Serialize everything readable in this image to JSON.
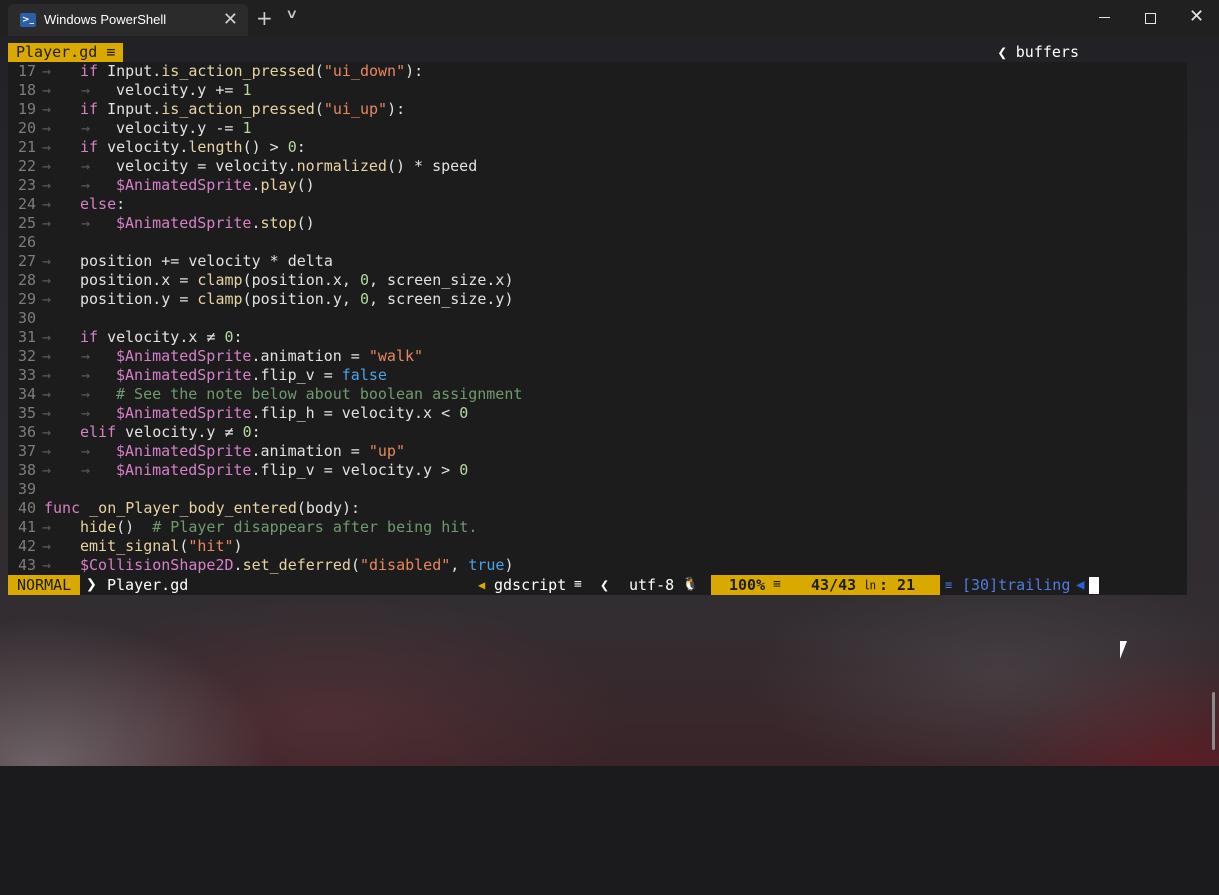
{
  "window": {
    "tab_title": "Windows PowerShell",
    "tab_close": "✕",
    "new_tab": "+",
    "tab_dropdown": "∨",
    "close_glyph": "✕"
  },
  "vim": {
    "buffer_tab": "Player.gd ≡",
    "buffers_label": "buffers",
    "buffers_chevron": "❮"
  },
  "editor": {
    "lines": [
      {
        "n": "17",
        "indent": 1,
        "tokens": [
          [
            "kw",
            "if "
          ],
          [
            "plain",
            "Input"
          ],
          [
            "plain",
            "."
          ],
          [
            "fn",
            "is_action_pressed"
          ],
          [
            "plain",
            "("
          ],
          [
            "str",
            "\"ui_down\""
          ],
          [
            "plain",
            "):"
          ]
        ]
      },
      {
        "n": "18",
        "indent": 2,
        "tokens": [
          [
            "plain",
            "velocity.y += "
          ],
          [
            "num",
            "1"
          ]
        ]
      },
      {
        "n": "19",
        "indent": 1,
        "tokens": [
          [
            "kw",
            "if "
          ],
          [
            "plain",
            "Input"
          ],
          [
            "plain",
            "."
          ],
          [
            "fn",
            "is_action_pressed"
          ],
          [
            "plain",
            "("
          ],
          [
            "str",
            "\"ui_up\""
          ],
          [
            "plain",
            "):"
          ]
        ]
      },
      {
        "n": "20",
        "indent": 2,
        "tokens": [
          [
            "plain",
            "velocity.y -= "
          ],
          [
            "num",
            "1"
          ]
        ]
      },
      {
        "n": "21",
        "indent": 1,
        "tokens": [
          [
            "kw",
            "if "
          ],
          [
            "plain",
            "velocity."
          ],
          [
            "fn",
            "length"
          ],
          [
            "plain",
            "() > "
          ],
          [
            "num",
            "0"
          ],
          [
            "plain",
            ":"
          ]
        ]
      },
      {
        "n": "22",
        "indent": 2,
        "tokens": [
          [
            "plain",
            "velocity = velocity."
          ],
          [
            "fn",
            "normalized"
          ],
          [
            "plain",
            "() * speed"
          ]
        ]
      },
      {
        "n": "23",
        "indent": 2,
        "tokens": [
          [
            "node",
            "$AnimatedSprite"
          ],
          [
            "plain",
            "."
          ],
          [
            "fn",
            "play"
          ],
          [
            "plain",
            "()"
          ]
        ]
      },
      {
        "n": "24",
        "indent": 1,
        "tokens": [
          [
            "kw",
            "else"
          ],
          [
            "plain",
            ":"
          ]
        ]
      },
      {
        "n": "25",
        "indent": 2,
        "tokens": [
          [
            "node",
            "$AnimatedSprite"
          ],
          [
            "plain",
            "."
          ],
          [
            "fn",
            "stop"
          ],
          [
            "plain",
            "()"
          ]
        ]
      },
      {
        "n": "26",
        "indent": 0,
        "tokens": []
      },
      {
        "n": "27",
        "indent": 1,
        "tokens": [
          [
            "plain",
            "position += velocity * delta"
          ]
        ]
      },
      {
        "n": "28",
        "indent": 1,
        "tokens": [
          [
            "plain",
            "position.x = "
          ],
          [
            "fn",
            "clamp"
          ],
          [
            "plain",
            "(position.x, "
          ],
          [
            "num",
            "0"
          ],
          [
            "plain",
            ", screen_size.x)"
          ]
        ]
      },
      {
        "n": "29",
        "indent": 1,
        "tokens": [
          [
            "plain",
            "position.y = "
          ],
          [
            "fn",
            "clamp"
          ],
          [
            "plain",
            "(position.y, "
          ],
          [
            "num",
            "0"
          ],
          [
            "plain",
            ", screen_size.y)"
          ]
        ]
      },
      {
        "n": "30",
        "indent": 0,
        "tokens": []
      },
      {
        "n": "31",
        "indent": 1,
        "tokens": [
          [
            "kw",
            "if "
          ],
          [
            "plain",
            "velocity.x ≠ "
          ],
          [
            "num",
            "0"
          ],
          [
            "plain",
            ":"
          ]
        ]
      },
      {
        "n": "32",
        "indent": 2,
        "tokens": [
          [
            "node",
            "$AnimatedSprite"
          ],
          [
            "plain",
            ".animation = "
          ],
          [
            "str",
            "\"walk\""
          ]
        ]
      },
      {
        "n": "33",
        "indent": 2,
        "tokens": [
          [
            "node",
            "$AnimatedSprite"
          ],
          [
            "plain",
            ".flip_v = "
          ],
          [
            "bool",
            "false"
          ]
        ]
      },
      {
        "n": "34",
        "indent": 2,
        "tokens": [
          [
            "cm",
            "# See the note below about boolean assignment"
          ]
        ]
      },
      {
        "n": "35",
        "indent": 2,
        "tokens": [
          [
            "node",
            "$AnimatedSprite"
          ],
          [
            "plain",
            ".flip_h = velocity.x < "
          ],
          [
            "num",
            "0"
          ]
        ]
      },
      {
        "n": "36",
        "indent": 1,
        "tokens": [
          [
            "kw",
            "elif "
          ],
          [
            "plain",
            "velocity.y ≠ "
          ],
          [
            "num",
            "0"
          ],
          [
            "plain",
            ":"
          ]
        ]
      },
      {
        "n": "37",
        "indent": 2,
        "tokens": [
          [
            "node",
            "$AnimatedSprite"
          ],
          [
            "plain",
            ".animation = "
          ],
          [
            "str",
            "\"up\""
          ]
        ]
      },
      {
        "n": "38",
        "indent": 2,
        "tokens": [
          [
            "node",
            "$AnimatedSprite"
          ],
          [
            "plain",
            ".flip_v = velocity.y > "
          ],
          [
            "num",
            "0"
          ]
        ]
      },
      {
        "n": "39",
        "indent": 0,
        "tokens": []
      },
      {
        "n": "40",
        "indent": 0,
        "tokens": [
          [
            "kw",
            "func "
          ],
          [
            "fn",
            "_on_Player_body_entered"
          ],
          [
            "plain",
            "(body):"
          ]
        ]
      },
      {
        "n": "41",
        "indent": 1,
        "tokens": [
          [
            "fn",
            "hide"
          ],
          [
            "plain",
            "()  "
          ],
          [
            "cm",
            "# Player disappears after being hit."
          ]
        ]
      },
      {
        "n": "42",
        "indent": 1,
        "tokens": [
          [
            "fn",
            "emit_signal"
          ],
          [
            "plain",
            "("
          ],
          [
            "str",
            "\"hit\""
          ],
          [
            "plain",
            ")"
          ]
        ]
      },
      {
        "n": "43",
        "indent": 1,
        "tokens": [
          [
            "node",
            "$CollisionShape2D"
          ],
          [
            "plain",
            "."
          ],
          [
            "fn",
            "set_deferred"
          ],
          [
            "plain",
            "("
          ],
          [
            "str",
            "\"disabled\""
          ],
          [
            "plain",
            ", "
          ],
          [
            "bool",
            "true"
          ],
          [
            "plain",
            ")"
          ]
        ]
      }
    ]
  },
  "statusline": {
    "mode": "NORMAL",
    "mode_sep": "❯",
    "filename": "Player.gd",
    "filetype_tri": "◀",
    "filetype": "gdscript",
    "filetype_icon": "≡",
    "encoding_chevron": "❮",
    "encoding": "utf-8",
    "os_icon": "🐧",
    "percent": "100%",
    "percent_icon": "≡",
    "line_info": "43/43",
    "line_icon": "㏑",
    "column": ": 21",
    "warn_icon": "≡",
    "trailing": "[30]trailing",
    "warn_tri": "◀"
  },
  "colors": {
    "accent_yellow": "#d9a900",
    "keyword": "#d680c8",
    "string": "#e8885f",
    "number": "#b7d8a2",
    "boolean": "#4aa3e8",
    "comment": "#6f9a6f",
    "warning_blue": "#4f7ddb"
  }
}
